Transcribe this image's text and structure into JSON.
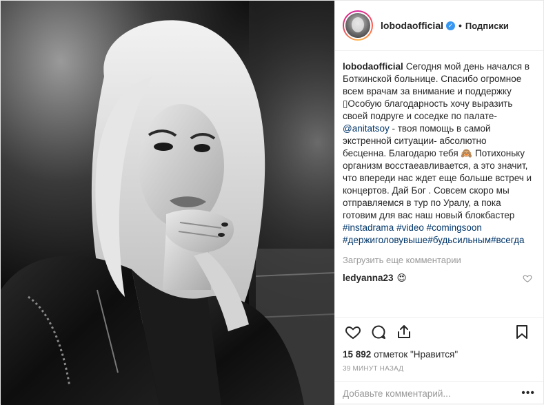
{
  "post": {
    "username": "lobodaofficial",
    "follow_label": "Подписки",
    "separator": "•",
    "verified_glyph": "✓",
    "caption": {
      "user": "lobodaofficial",
      "part1": "Сегодня мой день начался в Боткинской больнице. Спасибо огромное всем врачам за внимание и поддержку ▯Особую благодарность хочу выразить своей подруге и соседке по палате- ",
      "mention": "@anitatsoy",
      "part2": " - твоя помощь в самой экстренной ситуации- абсолютно бесценна. Благодарю тебя 🙈 Потихоньку организм восстаеавливается, а это значит, что впереди нас ждет еще больше встреч и концертов. Дай Бог . Совсем скоро мы отправляемся в тур по Уралу, а пока готовим для вас наш новый блокбастер ",
      "tag1": "#instadrama",
      "tag2": "#video",
      "tag3": "#comingsoon",
      "tag4": "#держиголовувыше",
      "tag5": "#будьсильным",
      "tag6": "#всегда"
    },
    "load_more": "Загрузить еще комментарии",
    "comment": {
      "user": "ledyanna23",
      "text": "😍"
    },
    "likes_count": "15 892",
    "likes_suffix": "отметок \"Нравится\"",
    "time_ago": "39 минут назад",
    "comment_placeholder": "Добавьте комментарий...",
    "more_glyph": "•••"
  },
  "icons": {
    "like": "heart-icon",
    "comment": "comment-bubble-icon",
    "share": "share-icon",
    "save": "bookmark-icon",
    "verified": "verified-badge-icon"
  },
  "colors": {
    "link": "#003569",
    "verified": "#3897f0",
    "muted": "#999999",
    "text": "#262626"
  }
}
